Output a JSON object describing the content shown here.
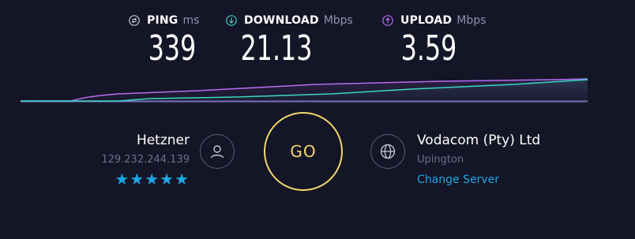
{
  "metrics": {
    "ping": {
      "label": "PING",
      "unit": "ms",
      "value": "339",
      "icon": "ping-icon",
      "color": "#ffffff"
    },
    "download": {
      "label": "DOWNLOAD",
      "unit": "Mbps",
      "value": "21.13",
      "icon": "download-arrow-icon",
      "color": "#3ad6c4"
    },
    "upload": {
      "label": "UPLOAD",
      "unit": "Mbps",
      "value": "3.59",
      "icon": "upload-arrow-icon",
      "color": "#b66cf2"
    }
  },
  "graph": {
    "colors": {
      "download": "#3ad6c4",
      "upload": "#b66cf2",
      "baseline": "#7a6fb8"
    }
  },
  "isp": {
    "name": "Hetzner",
    "ip": "129.232.244.139",
    "rating_stars": 5,
    "stars": "★★★★★",
    "icon": "user-icon"
  },
  "go_button": {
    "label": "GO",
    "color": "#f2d76c"
  },
  "server": {
    "name": "Vodacom (Pty) Ltd",
    "location": "Upington",
    "change_label": "Change Server",
    "icon": "globe-icon"
  },
  "colors": {
    "background": "#141526",
    "accent_blue": "#1ba7e6",
    "muted_text": "#6e7086"
  }
}
